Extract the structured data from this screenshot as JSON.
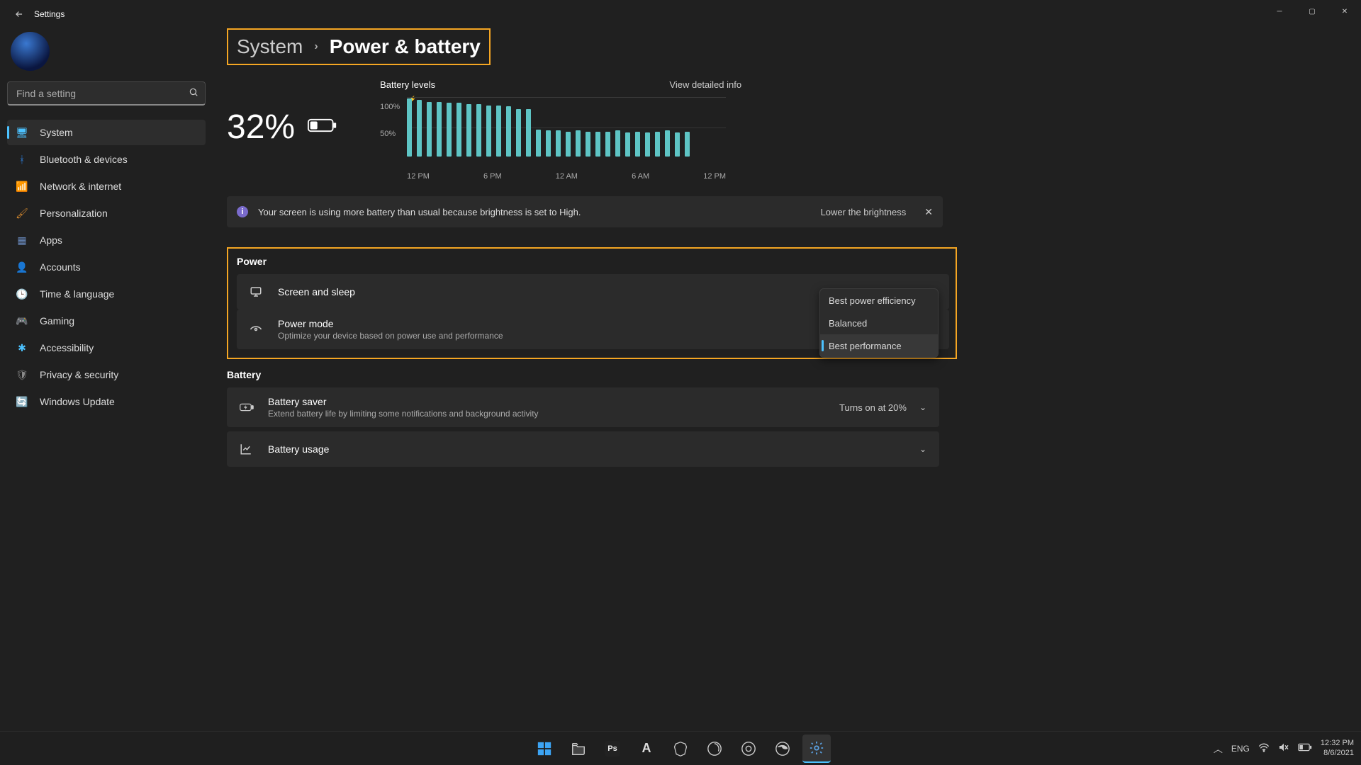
{
  "window": {
    "title": "Settings"
  },
  "search": {
    "placeholder": "Find a setting"
  },
  "sidebar": {
    "items": [
      {
        "label": "System",
        "icon": "display-icon",
        "color": "#4cc2ff",
        "active": true
      },
      {
        "label": "Bluetooth & devices",
        "icon": "bluetooth-icon",
        "color": "#2e7dd7"
      },
      {
        "label": "Network & internet",
        "icon": "wifi-icon",
        "color": "#2e9dd7"
      },
      {
        "label": "Personalization",
        "icon": "brush-icon",
        "color": "#d78a2e"
      },
      {
        "label": "Apps",
        "icon": "apps-icon",
        "color": "#6a8bbf"
      },
      {
        "label": "Accounts",
        "icon": "person-icon",
        "color": "#3fbf7f"
      },
      {
        "label": "Time & language",
        "icon": "clock-icon",
        "color": "#3a9bd2"
      },
      {
        "label": "Gaming",
        "icon": "gamepad-icon",
        "color": "#9a9a9a"
      },
      {
        "label": "Accessibility",
        "icon": "accessibility-icon",
        "color": "#4cc2ff"
      },
      {
        "label": "Privacy & security",
        "icon": "shield-icon",
        "color": "#8a8a8a"
      },
      {
        "label": "Windows Update",
        "icon": "update-icon",
        "color": "#2e7dd7"
      }
    ]
  },
  "breadcrumb": {
    "parent": "System",
    "current": "Power & battery"
  },
  "battery": {
    "percent": "32%",
    "levels_title": "Battery levels",
    "view_detailed": "View detailed info"
  },
  "chart_data": {
    "type": "bar",
    "title": "Battery levels",
    "ylabel": "",
    "ylim": [
      0,
      100
    ],
    "yticks": [
      "100%",
      "50%"
    ],
    "categories": [
      "12 PM",
      "6 PM",
      "12 AM",
      "6 AM",
      "12 PM"
    ],
    "values": [
      98,
      95,
      92,
      92,
      90,
      90,
      88,
      88,
      86,
      86,
      84,
      80,
      80,
      45,
      44,
      44,
      42,
      44,
      42,
      42,
      42,
      44,
      40,
      42,
      40,
      42,
      44,
      40,
      42
    ]
  },
  "banner": {
    "message": "Your screen is using more battery than usual because brightness is set to High.",
    "action": "Lower the brightness"
  },
  "sections": {
    "power": {
      "title": "Power",
      "screen_sleep": "Screen and sleep",
      "power_mode": {
        "title": "Power mode",
        "sub": "Optimize your device based on power use and performance"
      },
      "options": [
        "Best power efficiency",
        "Balanced",
        "Best performance"
      ],
      "selected": "Best performance"
    },
    "battery": {
      "title": "Battery",
      "saver": {
        "title": "Battery saver",
        "sub": "Extend battery life by limiting some notifications and background activity",
        "right": "Turns on at 20%"
      },
      "usage": "Battery usage"
    }
  },
  "tray": {
    "lang": "ENG",
    "time": "12:32 PM",
    "date": "8/6/2021"
  }
}
